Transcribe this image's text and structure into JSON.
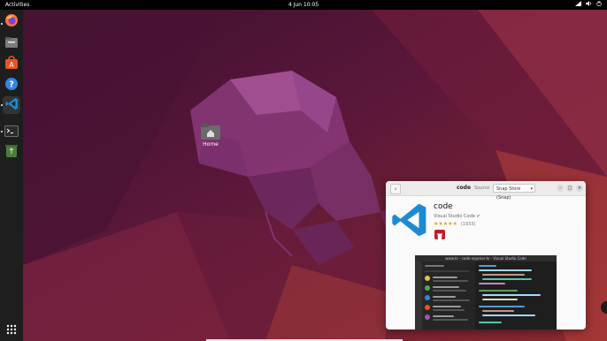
{
  "topbar": {
    "activities": "Activities",
    "clock": "4 Jun  10:05"
  },
  "dock": {
    "items": [
      {
        "name": "firefox",
        "icon": "firefox-icon"
      },
      {
        "name": "files",
        "icon": "files-icon"
      },
      {
        "name": "software",
        "icon": "ubuntu-software-icon"
      },
      {
        "name": "help",
        "icon": "help-icon"
      },
      {
        "name": "vscode",
        "icon": "vscode-icon"
      },
      {
        "name": "terminal",
        "icon": "terminal-icon"
      },
      {
        "name": "trash",
        "icon": "trash-icon"
      }
    ],
    "apps_grid_icon": "show-apps-icon"
  },
  "desktop": {
    "home_label": "Home"
  },
  "software_window": {
    "title": "code",
    "source_label": "Source",
    "source_value": "Snap Store (Snap)",
    "app": {
      "name": "code",
      "developer": "Visual Studio Code",
      "rating_stars": "★★★★★",
      "rating_count": "(1933)"
    },
    "screenshot_title": "www.ts - code-express-ts - Visual Studio Code"
  },
  "colors": {
    "accent": "#e95420",
    "vscode_blue": "#1f8ad2",
    "remove_red": "#c01c28"
  }
}
